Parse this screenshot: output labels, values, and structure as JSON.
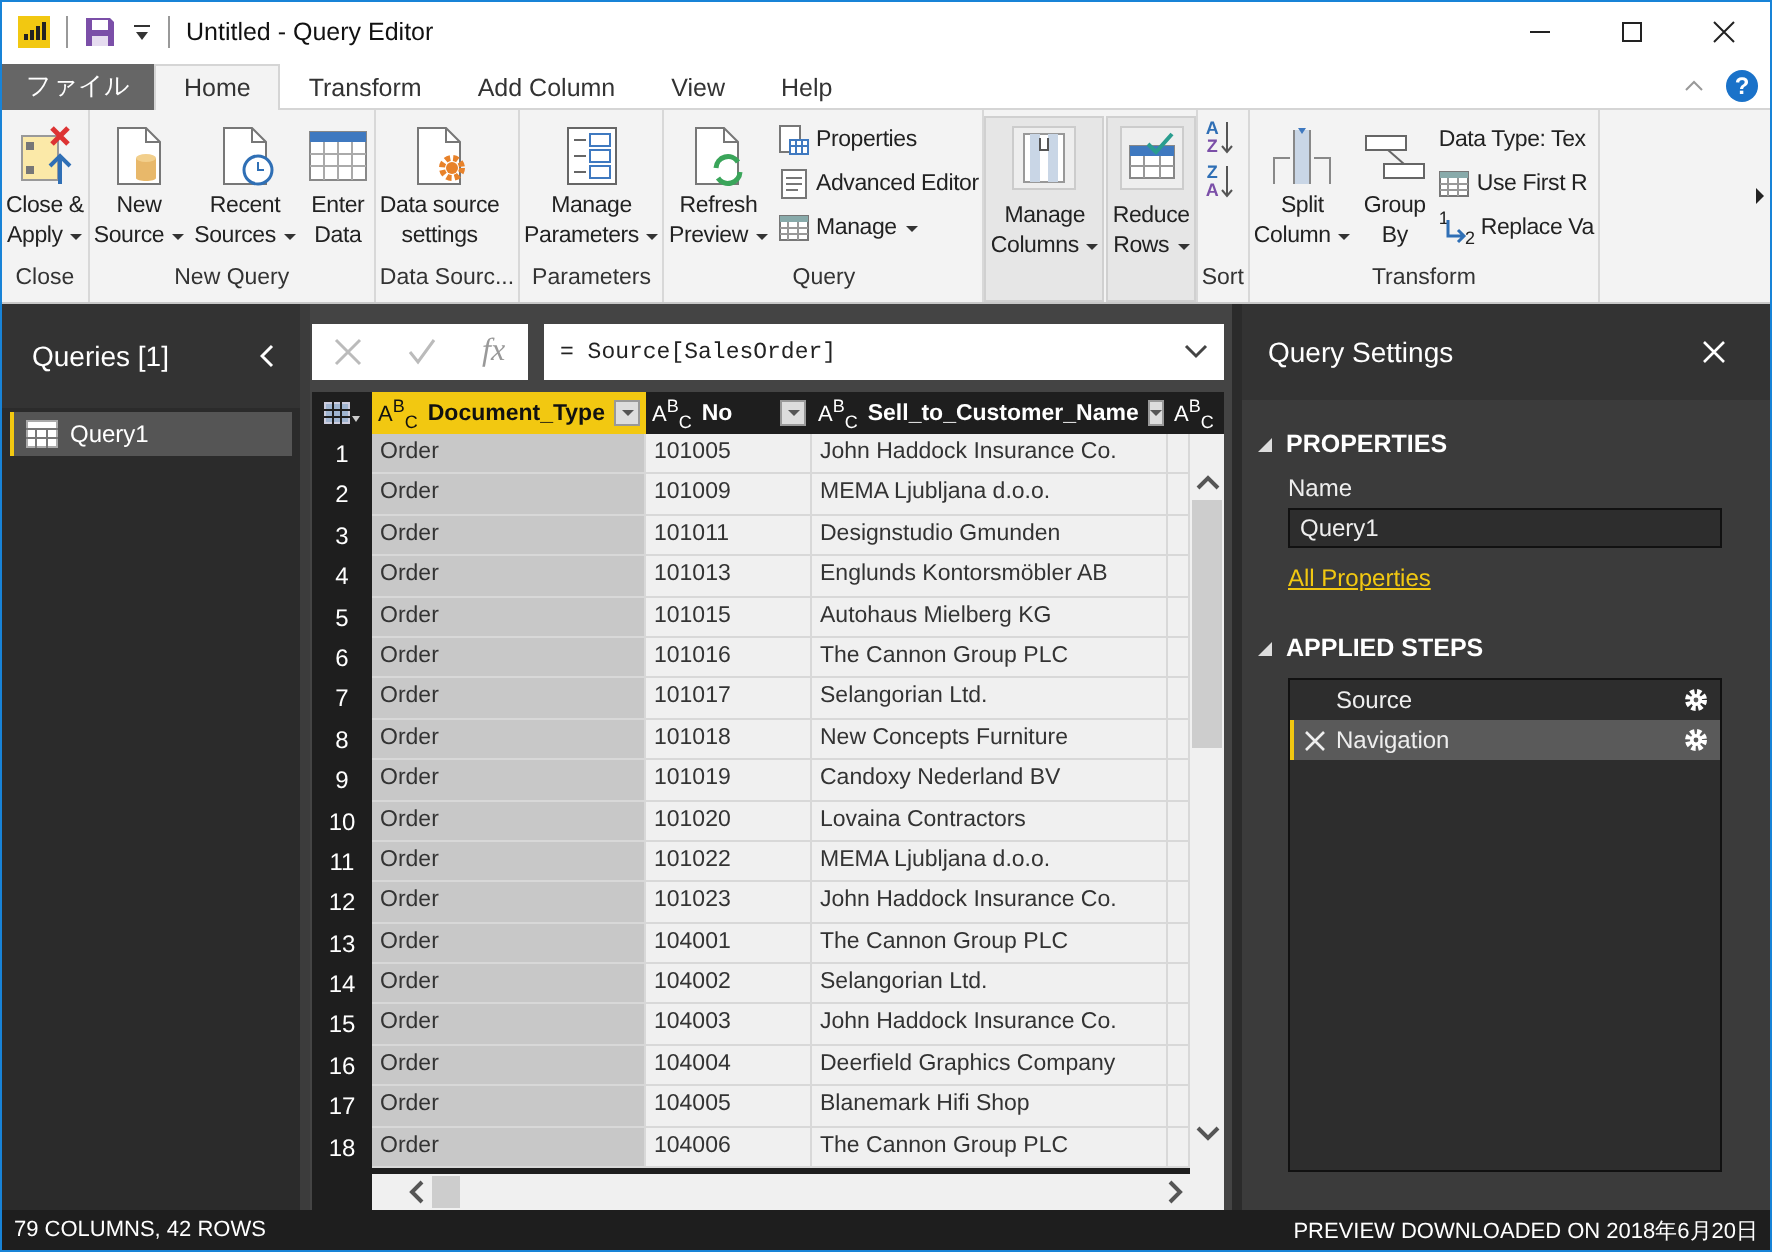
{
  "window": {
    "title": "Untitled - Query Editor"
  },
  "ribbon_tabs": [
    {
      "label": "ファイル",
      "kind": "file",
      "selected": false
    },
    {
      "label": "Home",
      "kind": "tab",
      "selected": true
    },
    {
      "label": "Transform",
      "kind": "tab",
      "selected": false
    },
    {
      "label": "Add Column",
      "kind": "tab",
      "selected": false
    },
    {
      "label": "View",
      "kind": "tab",
      "selected": false
    },
    {
      "label": "Help",
      "kind": "tab",
      "selected": false
    }
  ],
  "help": "?",
  "ribbon": {
    "groups": [
      {
        "label": "Close",
        "buttons": [
          {
            "kind": "large",
            "lines": [
              "Close &",
              "Apply"
            ],
            "dropdown": true
          }
        ]
      },
      {
        "label": "New Query",
        "buttons": [
          {
            "kind": "large",
            "lines": [
              "New",
              "Source"
            ],
            "dropdown": true
          },
          {
            "kind": "large",
            "lines": [
              "Recent",
              "Sources"
            ],
            "dropdown": true
          },
          {
            "kind": "large",
            "lines": [
              "Enter",
              "Data"
            ],
            "dropdown": false
          }
        ]
      },
      {
        "label": "Data Sourc...",
        "buttons": [
          {
            "kind": "large",
            "lines": [
              "Data source",
              "settings"
            ],
            "dropdown": false
          }
        ]
      },
      {
        "label": "Parameters",
        "buttons": [
          {
            "kind": "large",
            "lines": [
              "Manage",
              "Parameters"
            ],
            "dropdown": true
          }
        ]
      },
      {
        "label": "Query",
        "buttons": [
          {
            "kind": "large",
            "lines": [
              "Refresh",
              "Preview"
            ],
            "dropdown": true
          },
          {
            "kind": "stack",
            "items": [
              {
                "label": "Properties",
                "dropdown": false
              },
              {
                "label": "Advanced Editor",
                "dropdown": false
              },
              {
                "label": "Manage",
                "dropdown": true
              }
            ]
          }
        ]
      },
      {
        "buttons": [
          {
            "kind": "boxed",
            "lines": [
              "Manage",
              "Columns"
            ],
            "dropdown": true
          },
          {
            "kind": "boxed",
            "lines": [
              "Reduce",
              "Rows"
            ],
            "dropdown": true
          }
        ]
      },
      {
        "label": "Sort",
        "buttons": [
          {
            "kind": "sort",
            "items": [
              {
                "top": "A",
                "bottom": "Z"
              },
              {
                "top": "Z",
                "bottom": "A"
              }
            ]
          }
        ]
      },
      {
        "label": "Transform",
        "buttons": [
          {
            "kind": "large",
            "lines": [
              "Split",
              "Column"
            ],
            "dropdown": true
          },
          {
            "kind": "large",
            "lines": [
              "Group",
              "By"
            ],
            "dropdown": false
          },
          {
            "kind": "stack",
            "items": [
              {
                "label": "Data Type: Tex",
                "dropdown": false
              },
              {
                "label": "Use First R",
                "dropdown": false
              },
              {
                "marks": [
                  "1",
                  "2"
                ],
                "label": "Replace Va",
                "dropdown": false
              }
            ]
          }
        ]
      }
    ]
  },
  "queries_panel": {
    "title": "Queries [1]",
    "items": [
      {
        "label": "Query1",
        "selected": true
      }
    ]
  },
  "formula_bar": {
    "fx": "fx",
    "formula": "= Source[SalesOrder]"
  },
  "table": {
    "columns": [
      {
        "type": "A$^{B}$$_{C}$",
        "name": "Document_Type",
        "selected": true
      },
      {
        "type": "A$^{B}$$_{C}$",
        "name": "No",
        "selected": false
      },
      {
        "type": "A$^{B}$$_{C}$",
        "name": "Sell_to_Customer_Name",
        "selected": false
      },
      {
        "type": "A$^{B}$$_{C}$",
        "selected": false
      }
    ],
    "rows": [
      {
        "number": "1",
        "cells": [
          "Order",
          "101005",
          "John Haddock Insurance Co."
        ]
      },
      {
        "number": "2",
        "cells": [
          "Order",
          "101009",
          "MEMA Ljubljana d.o.o."
        ]
      },
      {
        "number": "3",
        "cells": [
          "Order",
          "101011",
          "Designstudio Gmunden"
        ]
      },
      {
        "number": "4",
        "cells": [
          "Order",
          "101013",
          "Englunds Kontorsmöbler AB"
        ]
      },
      {
        "number": "5",
        "cells": [
          "Order",
          "101015",
          "Autohaus Mielberg KG"
        ]
      },
      {
        "number": "6",
        "cells": [
          "Order",
          "101016",
          "The Cannon Group PLC"
        ]
      },
      {
        "number": "7",
        "cells": [
          "Order",
          "101017",
          "Selangorian Ltd."
        ]
      },
      {
        "number": "8",
        "cells": [
          "Order",
          "101018",
          "New Concepts Furniture"
        ]
      },
      {
        "number": "9",
        "cells": [
          "Order",
          "101019",
          "Candoxy Nederland BV"
        ]
      },
      {
        "number": "10",
        "cells": [
          "Order",
          "101020",
          "Lovaina Contractors"
        ]
      },
      {
        "number": "11",
        "cells": [
          "Order",
          "101022",
          "MEMA Ljubljana d.o.o."
        ]
      },
      {
        "number": "12",
        "cells": [
          "Order",
          "101023",
          "John Haddock Insurance Co."
        ]
      },
      {
        "number": "13",
        "cells": [
          "Order",
          "104001",
          "The Cannon Group PLC"
        ]
      },
      {
        "number": "14",
        "cells": [
          "Order",
          "104002",
          "Selangorian Ltd."
        ]
      },
      {
        "number": "15",
        "cells": [
          "Order",
          "104003",
          "John Haddock Insurance Co."
        ]
      },
      {
        "number": "16",
        "cells": [
          "Order",
          "104004",
          "Deerfield Graphics Company"
        ]
      },
      {
        "number": "17",
        "cells": [
          "Order",
          "104005",
          "Blanemark Hifi Shop"
        ]
      },
      {
        "number": "18",
        "cells": [
          "Order",
          "104006",
          "The Cannon Group PLC"
        ]
      }
    ]
  },
  "query_settings": {
    "title": "Query Settings",
    "properties": {
      "heading": "PROPERTIES",
      "name_label": "Name",
      "name_value": "Query1",
      "link": "All Properties"
    },
    "applied_steps": {
      "heading": "APPLIED STEPS",
      "steps": [
        {
          "label": "Source",
          "selected": false,
          "has_settings": true
        },
        {
          "label": "Navigation",
          "selected": true,
          "has_settings": true
        }
      ]
    }
  },
  "status_bar": {
    "left": "79 COLUMNS, 42 ROWS",
    "right": "PREVIEW DOWNLOADED ON 2018年6月20日"
  }
}
